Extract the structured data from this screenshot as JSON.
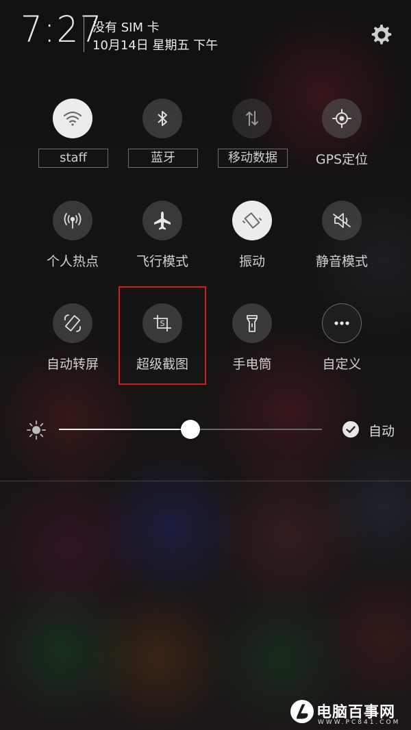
{
  "status": {
    "time": "7:27",
    "sim": "没有 SIM 卡",
    "date": "10月14日 星期五 下午",
    "settings_icon": "gear-icon"
  },
  "toggles": [
    {
      "label": "staff",
      "icon": "wifi-icon",
      "active": true
    },
    {
      "label": "蓝牙",
      "icon": "bluetooth-icon",
      "active": false
    },
    {
      "label": "移动数据",
      "icon": "mobile-data-icon",
      "active": false
    },
    {
      "label": "GPS定位",
      "icon": "gps-icon",
      "active": false
    },
    {
      "label": "个人热点",
      "icon": "hotspot-icon",
      "active": false
    },
    {
      "label": "飞行模式",
      "icon": "airplane-icon",
      "active": false
    },
    {
      "label": "振动",
      "icon": "vibrate-icon",
      "active": true
    },
    {
      "label": "静音模式",
      "icon": "mute-icon",
      "active": false
    },
    {
      "label": "自动转屏",
      "icon": "auto-rotate-icon",
      "active": false
    },
    {
      "label": "超级截图",
      "icon": "super-screenshot-icon",
      "active": false
    },
    {
      "label": "手电筒",
      "icon": "flashlight-icon",
      "active": false
    },
    {
      "label": "自定义",
      "icon": "more-icon",
      "active": false
    }
  ],
  "brightness": {
    "level": 0.5,
    "auto_label": "自动",
    "auto_checked": true
  },
  "watermark": {
    "name": "电脑百事网",
    "url": "WWW.PC841.COM"
  },
  "colors": {
    "highlight": "#d01d1d",
    "active_toggle": "#ececec"
  }
}
